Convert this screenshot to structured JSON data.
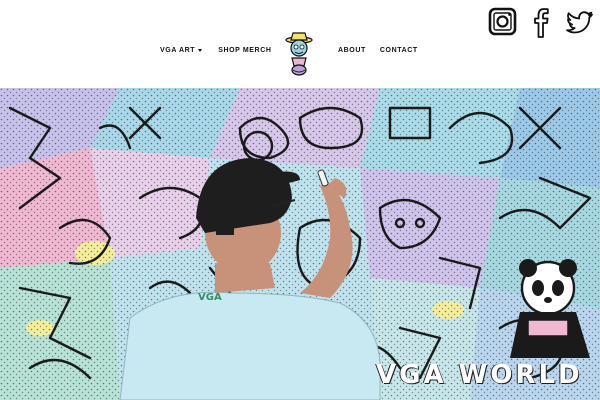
{
  "nav": {
    "vga_art_label": "VGA ART",
    "shop_merch_label": "SHOP MERCH",
    "about_label": "ABOUT",
    "contact_label": "CONTACT"
  },
  "social": {
    "icons": [
      "instagram-icon",
      "facebook-icon",
      "twitter-icon"
    ]
  },
  "hero": {
    "title": "VGA WORLD",
    "shirt_text": "VGA"
  },
  "colors": {
    "header_bg": "#ffffff",
    "nav_text": "#111111",
    "mural_outline": "#1a1a1a",
    "mural_light_blue": "#a9d8ea",
    "mural_pink": "#e9b7cf",
    "shirt": "#c8e8f2",
    "cap": "#1e1e1e"
  }
}
